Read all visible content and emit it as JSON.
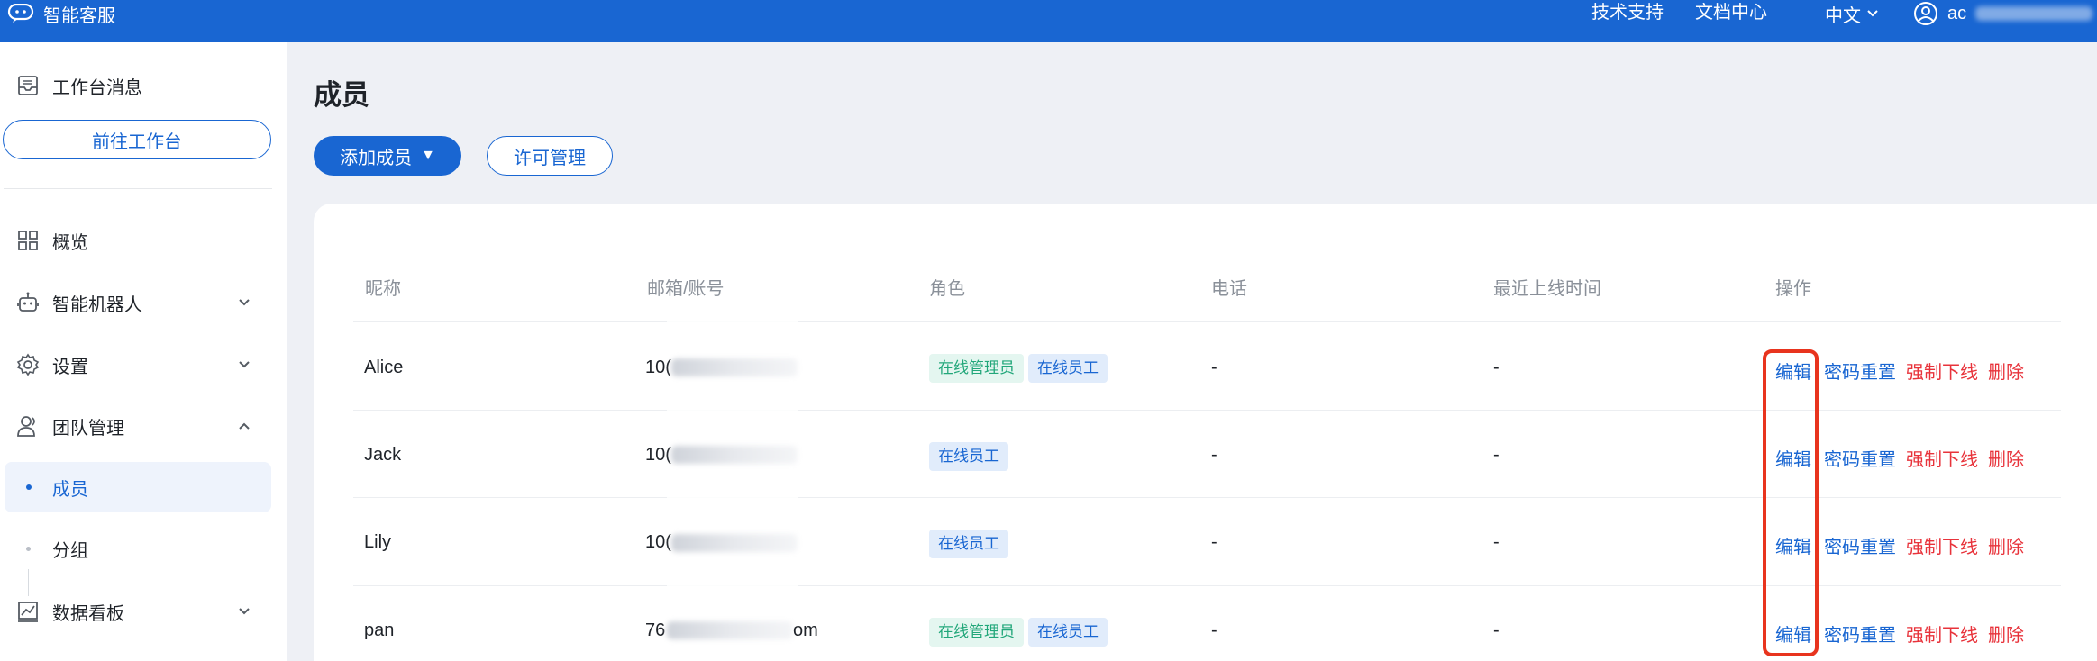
{
  "topbar": {
    "brand": "智能客服",
    "tech_support": "技术支持",
    "docs": "文档中心",
    "language": "中文",
    "user_visible": "ac"
  },
  "sidebar": {
    "workbench_messages": "工作台消息",
    "goto_workbench": "前往工作台",
    "items": [
      {
        "label": "概览",
        "icon": "grid-icon"
      },
      {
        "label": "智能机器人",
        "icon": "robot-icon"
      },
      {
        "label": "设置",
        "icon": "gear-icon"
      },
      {
        "label": "团队管理",
        "icon": "team-icon"
      },
      {
        "label": "数据看板",
        "icon": "chart-icon"
      }
    ],
    "team_sub": [
      {
        "label": "成员",
        "active": true
      },
      {
        "label": "分组",
        "active": false
      }
    ]
  },
  "main": {
    "title": "成员",
    "add_member": "添加成员",
    "add_member_caret": "▼",
    "license": "许可管理",
    "columns": [
      "昵称",
      "邮箱/账号",
      "角色",
      "电话",
      "最近上线时间",
      "操作"
    ],
    "rows": [
      {
        "name": "Alice",
        "email_prefix": "10(",
        "email_suffix": "",
        "roles": [
          "在线管理员",
          "在线员工"
        ],
        "phone": "-",
        "last_online": "-"
      },
      {
        "name": "Jack",
        "email_prefix": "10(",
        "email_suffix": "",
        "roles": [
          "在线员工"
        ],
        "phone": "-",
        "last_online": "-"
      },
      {
        "name": "Lily",
        "email_prefix": "10(",
        "email_suffix": "",
        "roles": [
          "在线员工"
        ],
        "phone": "-",
        "last_online": "-"
      },
      {
        "name": "pan",
        "email_prefix": "76",
        "email_suffix": "om",
        "roles": [
          "在线管理员",
          "在线员工"
        ],
        "phone": "-",
        "last_online": "-"
      }
    ],
    "actions": {
      "edit": "编辑",
      "reset_password": "密码重置",
      "force_offline": "强制下线",
      "delete": "删除"
    }
  },
  "colors": {
    "primary": "#1966d2",
    "danger": "#e8333b",
    "admin_tag": "#22a77a",
    "highlight": "#e8341e"
  }
}
